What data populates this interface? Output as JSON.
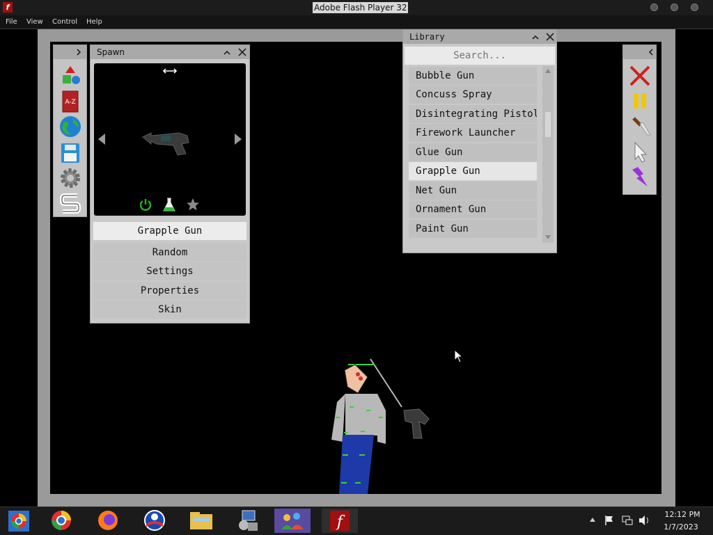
{
  "window": {
    "title": "Adobe Flash Player 32"
  },
  "menu": [
    "File",
    "View",
    "Control",
    "Help"
  ],
  "spawn_panel": {
    "title": "Spawn",
    "selected_item": "Grapple Gun",
    "buttons": [
      "Random",
      "Settings",
      "Properties",
      "Skin"
    ]
  },
  "library_panel": {
    "title": "Library",
    "search_placeholder": "Search...",
    "items": [
      "Bubble Gun",
      "Concuss Spray",
      "Disintegrating Pistol",
      "Firework Launcher",
      "Glue Gun",
      "Grapple Gun",
      "Net Gun",
      "Ornament Gun",
      "Paint Gun"
    ],
    "selected": "Grapple Gun"
  },
  "left_toolbar_icons": [
    "shapes-icon",
    "dictionary-icon",
    "globe-icon",
    "save-icon",
    "gear-icon",
    "s-logo-icon"
  ],
  "right_toolbar_icons": [
    "delete-x-icon",
    "pause-icon",
    "knife-icon",
    "cursor-icon",
    "lightning-icon"
  ],
  "taskbar": {
    "apps": [
      "chrome-frame-icon",
      "chrome-icon",
      "firefox-icon",
      "obama-logo-icon",
      "file-explorer-icon",
      "network-settings-icon",
      "users-icon",
      "flash-player-icon"
    ],
    "time": "12:12 PM",
    "date": "1/7/2023"
  },
  "colors": {
    "accent_red": "#cc2020",
    "pause_yellow": "#f0c800",
    "power_green": "#20b020"
  }
}
